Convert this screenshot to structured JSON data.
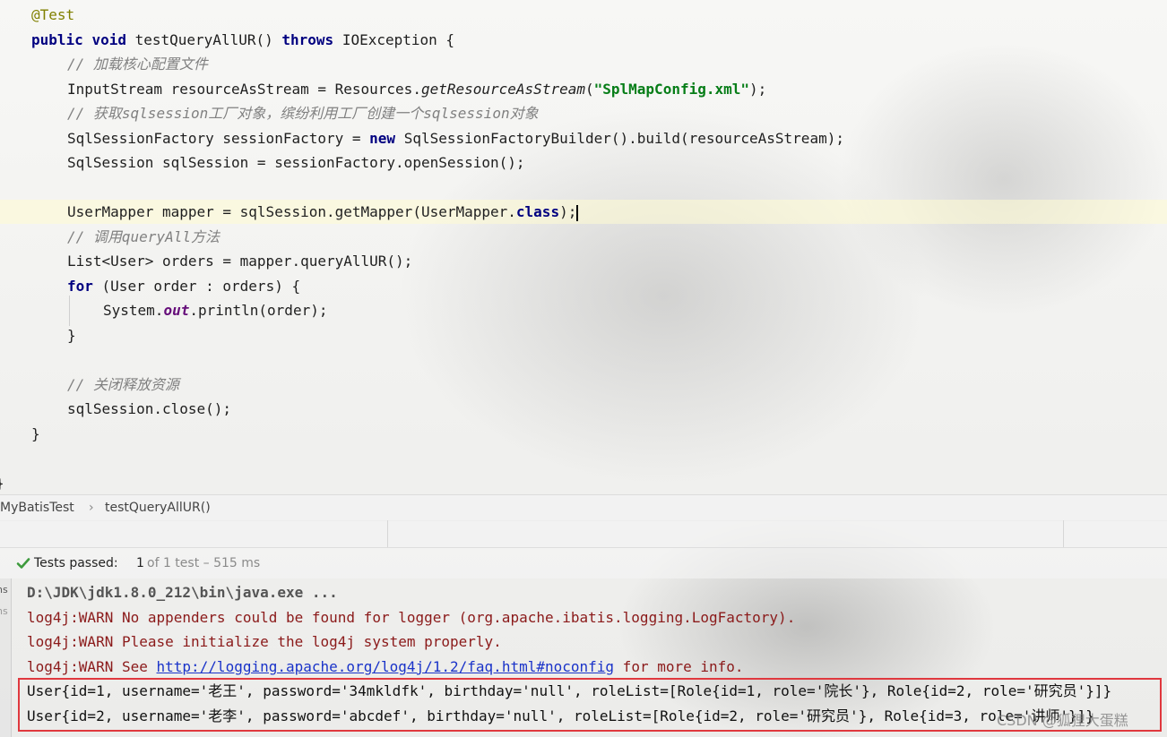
{
  "editor": {
    "annotation": "@Test",
    "sig_kw1": "public",
    "sig_kw2": "void",
    "sig_name": "testQueryAllUR()",
    "sig_throws": "throws",
    "sig_exc": "IOException {",
    "c1": "// 加载核心配置文件",
    "l3_a": "InputStream resourceAsStream = Resources.",
    "l3_b": "getResourceAsStream",
    "l3_c": "(",
    "l3_str": "\"SplMapConfig.xml\"",
    "l3_d": ");",
    "c2_a": "// 获取",
    "c2_b": "sqlsession",
    "c2_c": "工厂对象，缤纷利用工厂创建一个",
    "c2_d": "sqlsession",
    "c2_e": "对象",
    "l5_a": "SqlSessionFactory sessionFactory = ",
    "l5_new": "new",
    "l5_b": " SqlSessionFactoryBuilder().build(resourceAsStream);",
    "l6": "SqlSession sqlSession = sessionFactory.openSession();",
    "l8_a": "UserMapper mapper = sqlSession.getMapper(UserMapper.",
    "l8_cls": "class",
    "l8_b": ");",
    "c3_a": "// 调用",
    "c3_b": "queryAll",
    "c3_c": "方法",
    "l10": "List<User> orders = mapper.queryAllUR();",
    "l11_for": "for",
    "l11_b": " (User order : orders) {",
    "l12_a": "System.",
    "l12_out": "out",
    "l12_b": ".println(order);",
    "l13": "}",
    "c4": "// 关闭释放资源",
    "l15": "sqlSession.close();",
    "l16": "}",
    "l17": "}"
  },
  "breadcrumb": {
    "class_name": "MyBatisTest",
    "separator": "›",
    "method_name": "testQueryAllUR()"
  },
  "run": {
    "status_label": "Tests passed:",
    "passed_count": "1",
    "status_rest": "of 1 test – 515 ms",
    "gutter_text_1": "ns",
    "gutter_text_2": "ns"
  },
  "console": {
    "cmd": "D:\\JDK\\jdk1.8.0_212\\bin\\java.exe ...",
    "warn1": "log4j:WARN No appenders could be found for logger (org.apache.ibatis.logging.LogFactory).",
    "warn2": "log4j:WARN Please initialize the log4j system properly.",
    "warn3_a": "log4j:WARN See ",
    "warn3_link": "http://logging.apache.org/log4j/1.2/faq.html#noconfig",
    "warn3_b": " for more info.",
    "out1": "User{id=1, username='老王', password='34mkldfk', birthday='null', roleList=[Role{id=1, role='院长'}, Role{id=2, role='研究员'}]}",
    "out2": "User{id=2, username='老李', password='abcdef', birthday='null', roleList=[Role{id=2, role='研究员'}, Role{id=3, role='讲师'}]}"
  },
  "watermark": "CSDN @狐狸大蛋糕",
  "colors": {
    "keyword": "#000080",
    "string": "#067d17",
    "comment": "#808080",
    "warn": "#8b1a1a",
    "pass_green": "#3d9a3d",
    "highlight_box": "#e0383e"
  }
}
